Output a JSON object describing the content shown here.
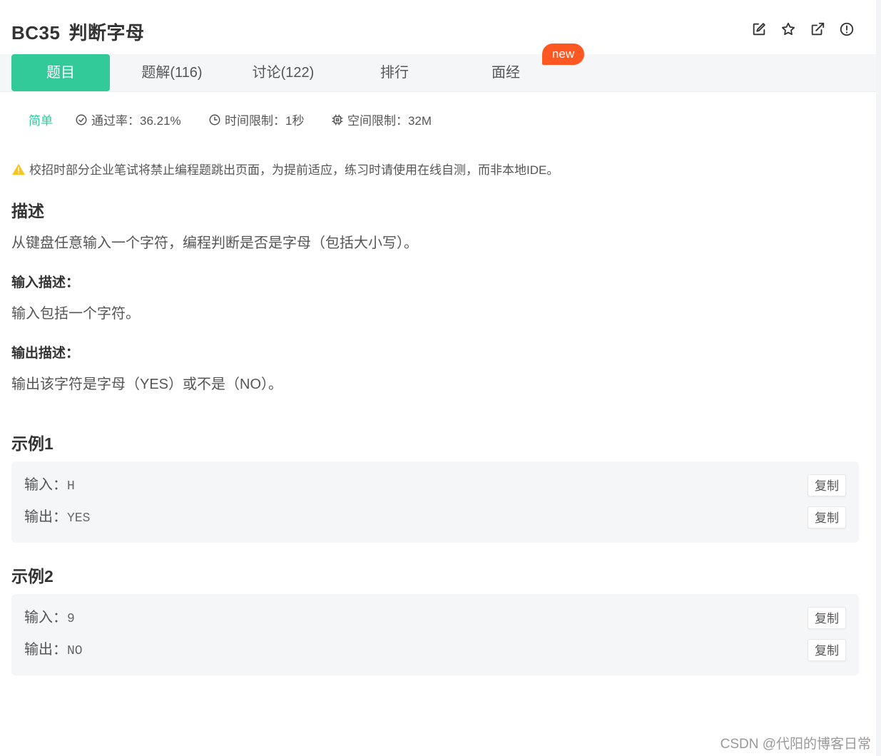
{
  "header": {
    "problem_id": "BC35",
    "problem_title": "判断字母",
    "icons": [
      "edit-icon",
      "star-icon",
      "share-icon",
      "report-icon"
    ]
  },
  "tabs": [
    {
      "label": "题目",
      "active": true
    },
    {
      "label": "题解(116)",
      "active": false
    },
    {
      "label": "讨论(122)",
      "active": false
    },
    {
      "label": "排行",
      "active": false
    },
    {
      "label": "面经",
      "active": false
    }
  ],
  "new_badge": "new",
  "meta": {
    "difficulty": "简单",
    "pass_rate": "通过率：36.21%",
    "time_limit": "时间限制：1秒",
    "space_limit": "空间限制：32M"
  },
  "warning": "校招时部分企业笔试将禁止编程题跳出页面，为提前适应，练习时请使用在线自测，而非本地IDE。",
  "description": {
    "heading": "描述",
    "text": "从键盘任意输入一个字符，编程判断是否是字母（包括大小写）。"
  },
  "input_desc": {
    "heading": "输入描述：",
    "text": "输入包括一个字符。"
  },
  "output_desc": {
    "heading": "输出描述：",
    "text": "输出该字符是字母（YES）或不是（NO）。"
  },
  "examples": [
    {
      "heading": "示例1",
      "input_label": "输入：",
      "input": "H",
      "output_label": "输出：",
      "output": "YES",
      "copy_label": "复制"
    },
    {
      "heading": "示例2",
      "input_label": "输入：",
      "input": "9",
      "output_label": "输出：",
      "output": "NO",
      "copy_label": "复制"
    }
  ],
  "colors": {
    "accent": "#32ca99",
    "new_badge": "#fe5722",
    "warning": "#f7c325"
  },
  "watermark": "CSDN @代阳的博客日常"
}
